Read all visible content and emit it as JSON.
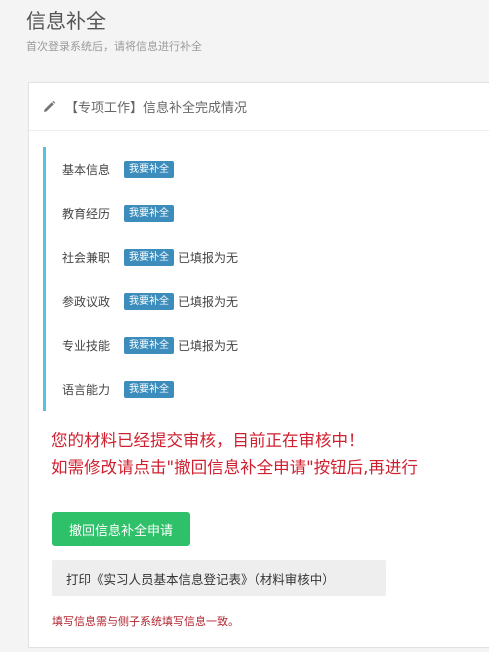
{
  "header": {
    "title": "信息补全",
    "subtitle": "首次登录系统后，请将信息进行补全"
  },
  "panel": {
    "title": "【专项工作】信息补全完成情况",
    "items": [
      {
        "label": "基本信息",
        "badge": "我要补全",
        "status": ""
      },
      {
        "label": "教育经历",
        "badge": "我要补全",
        "status": ""
      },
      {
        "label": "社会兼职",
        "badge": "我要补全",
        "status": "已填报为无"
      },
      {
        "label": "参政议政",
        "badge": "我要补全",
        "status": "已填报为无"
      },
      {
        "label": "专业技能",
        "badge": "我要补全",
        "status": "已填报为无"
      },
      {
        "label": "语言能力",
        "badge": "我要补全",
        "status": ""
      }
    ],
    "notice_line1": "您的材料已经提交审核，目前正在审核中！",
    "notice_line2": "如需修改请点击\"撤回信息补全申请\"按钮后,再进行",
    "revoke_button": "撤回信息补全申请",
    "print_button": "打印《实习人员基本信息登记表》（材料审核中）",
    "footnote": "填写信息需与侧子系统填写信息一致。"
  },
  "colors": {
    "badge": "#3c8dbc",
    "accent_border": "#5bc0de",
    "notice": "#d0202f",
    "revoke_button": "#2fc16a"
  }
}
